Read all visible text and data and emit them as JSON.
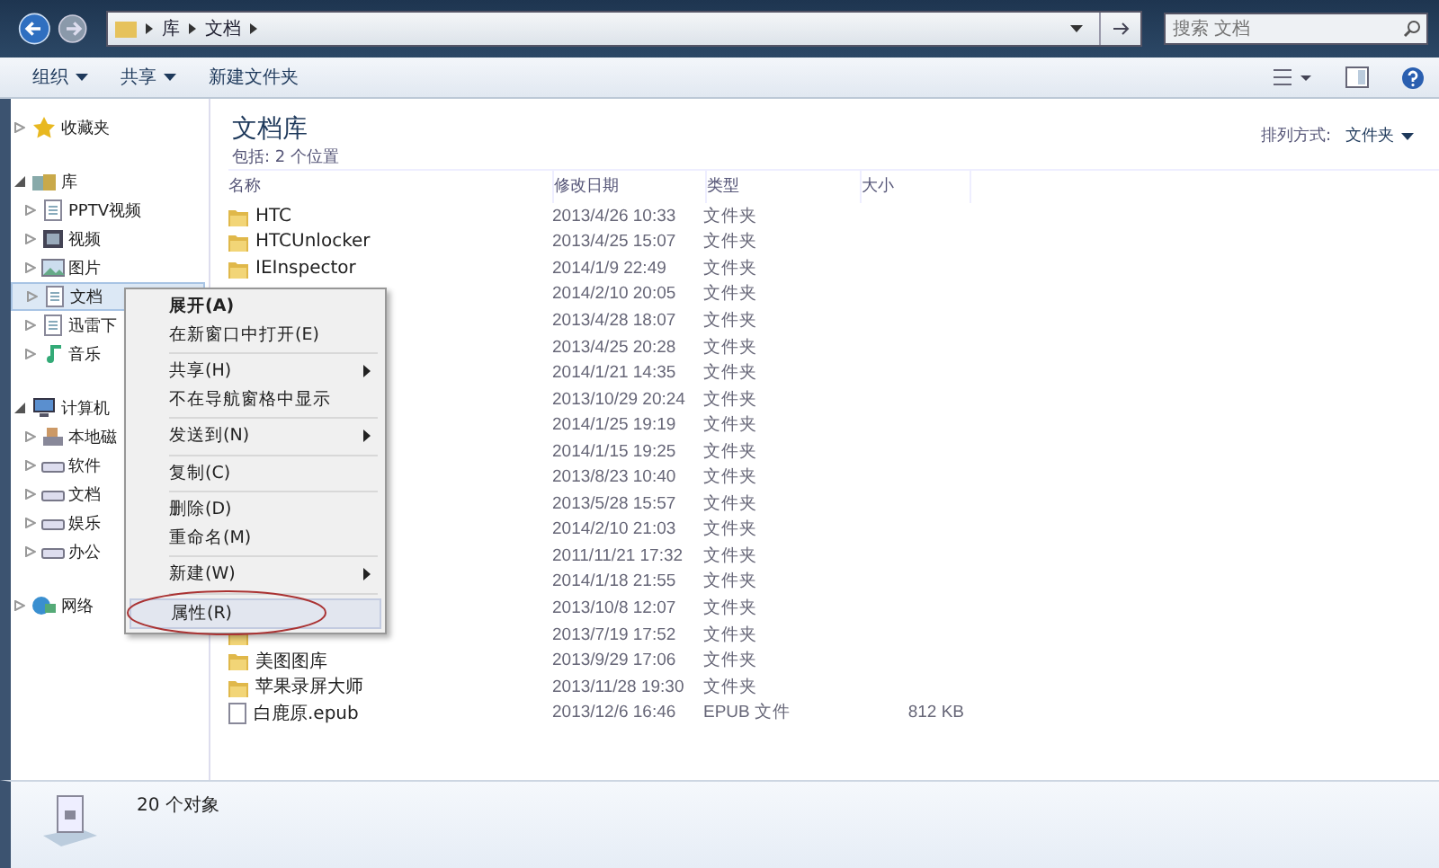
{
  "nav": {
    "breadcrumb": [
      "库",
      "文档"
    ],
    "search": {
      "placeholder": "搜索 文档"
    }
  },
  "toolbar": {
    "buttons": [
      {
        "label": "组织",
        "dropdown": true
      },
      {
        "label": "共享",
        "dropdown": true
      },
      {
        "label": "新建文件夹",
        "dropdown": false
      }
    ]
  },
  "sidebar": {
    "groups": [
      {
        "label": "收藏夹",
        "kind": "star",
        "expanded": false
      },
      {
        "label": "库",
        "kind": "library",
        "expanded": true,
        "children": [
          {
            "label": "PPTV视频",
            "kind": "doc",
            "selected": false
          },
          {
            "label": "视频",
            "kind": "video",
            "selected": false
          },
          {
            "label": "图片",
            "kind": "image",
            "selected": false
          },
          {
            "label": "文档",
            "kind": "doc",
            "selected": true
          },
          {
            "label": "迅雷下",
            "kind": "doc",
            "selected": false
          },
          {
            "label": "音乐",
            "kind": "music",
            "selected": false
          }
        ]
      },
      {
        "label": "计算机",
        "kind": "computer",
        "expanded": true,
        "children": [
          {
            "label": "本地磁",
            "kind": "system",
            "selected": false
          },
          {
            "label": "软件",
            "kind": "disk",
            "selected": false
          },
          {
            "label": "文档",
            "kind": "disk",
            "selected": false
          },
          {
            "label": "娱乐",
            "kind": "disk",
            "selected": false
          },
          {
            "label": "办公",
            "kind": "disk",
            "selected": false
          }
        ]
      },
      {
        "label": "网络",
        "kind": "network",
        "expanded": false
      }
    ]
  },
  "library": {
    "title": "文档库",
    "subtitle": "包括: 2 个位置",
    "arrange_label": "排列方式:",
    "arrange_value": "文件夹"
  },
  "table": {
    "columns": [
      "名称",
      "修改日期",
      "类型",
      "大小"
    ],
    "rows": [
      {
        "kind": "folder",
        "name": "HTC",
        "date": "2013/4/26 10:33",
        "type": "文件夹"
      },
      {
        "kind": "folder",
        "name": "HTCUnlocker",
        "date": "2013/4/25 15:07",
        "type": "文件夹"
      },
      {
        "kind": "folder",
        "name": "IEInspector",
        "date": "2014/1/9 22:49",
        "type": "文件夹"
      },
      {
        "date": "2014/2/10 20:05",
        "type": "文件夹"
      },
      {
        "date": "2013/4/28 18:07",
        "type": "文件夹"
      },
      {
        "date": "2013/4/25 20:28",
        "type": "文件夹"
      },
      {
        "date": "2014/1/21 14:35",
        "type": "文件夹"
      },
      {
        "kind": "folder",
        "date": "2013/10/29 20:24",
        "type": "文件夹"
      },
      {
        "kind": "folder",
        "date": "2014/1/25 19:19",
        "type": "文件夹"
      },
      {
        "kind": "folder",
        "date": "2014/1/15 19:25",
        "type": "文件夹"
      },
      {
        "kind": "folder",
        "date": "2013/8/23 10:40",
        "type": "文件夹"
      },
      {
        "kind": "folder",
        "date": "2013/5/28 15:57",
        "type": "文件夹"
      },
      {
        "kind": "folder",
        "date": "2014/2/10 21:03",
        "type": "文件夹"
      },
      {
        "kind": "folder",
        "date": "2011/11/21 17:32",
        "type": "文件夹"
      },
      {
        "kind": "folder",
        "date": "2014/1/18 21:55",
        "type": "文件夹"
      },
      {
        "kind": "folder",
        "date": "2013/10/8 12:07",
        "type": "文件夹"
      },
      {
        "kind": "folder",
        "date": "2013/7/19 17:52",
        "type": "文件夹"
      },
      {
        "kind": "folder",
        "name": "美图图库",
        "date": "2013/9/29 17:06",
        "type": "文件夹"
      },
      {
        "kind": "folder",
        "name": "苹果录屏大师",
        "date": "2013/11/28 19:30",
        "type": "文件夹"
      },
      {
        "kind": "file",
        "name": "白鹿原.epub",
        "date": "2013/12/6 16:46",
        "type": "EPUB 文件",
        "size": "812 KB"
      }
    ]
  },
  "context_menu": {
    "items": [
      {
        "kind": "item",
        "label": "展开(A)",
        "bold": true,
        "submenu": false,
        "highlighted": false
      },
      {
        "kind": "item",
        "label": "在新窗口中打开(E)",
        "bold": false,
        "submenu": false,
        "highlighted": false
      },
      {
        "kind": "separator"
      },
      {
        "kind": "item",
        "label": "共享(H)",
        "bold": false,
        "submenu": true,
        "highlighted": false
      },
      {
        "kind": "item",
        "label": "不在导航窗格中显示",
        "bold": false,
        "submenu": false,
        "highlighted": false
      },
      {
        "kind": "separator"
      },
      {
        "kind": "item",
        "label": "发送到(N)",
        "bold": false,
        "submenu": true,
        "highlighted": false
      },
      {
        "kind": "separator"
      },
      {
        "kind": "item",
        "label": "复制(C)",
        "bold": false,
        "submenu": false,
        "highlighted": false
      },
      {
        "kind": "separator"
      },
      {
        "kind": "item",
        "label": "删除(D)",
        "bold": false,
        "submenu": false,
        "highlighted": false
      },
      {
        "kind": "item",
        "label": "重命名(M)",
        "bold": false,
        "submenu": false,
        "highlighted": false
      },
      {
        "kind": "separator"
      },
      {
        "kind": "item",
        "label": "新建(W)",
        "bold": false,
        "submenu": true,
        "highlighted": false
      },
      {
        "kind": "separator"
      },
      {
        "kind": "item",
        "label": "属性(R)",
        "bold": false,
        "submenu": false,
        "highlighted": true
      }
    ]
  },
  "status_bar": {
    "text": "20 个对象"
  }
}
